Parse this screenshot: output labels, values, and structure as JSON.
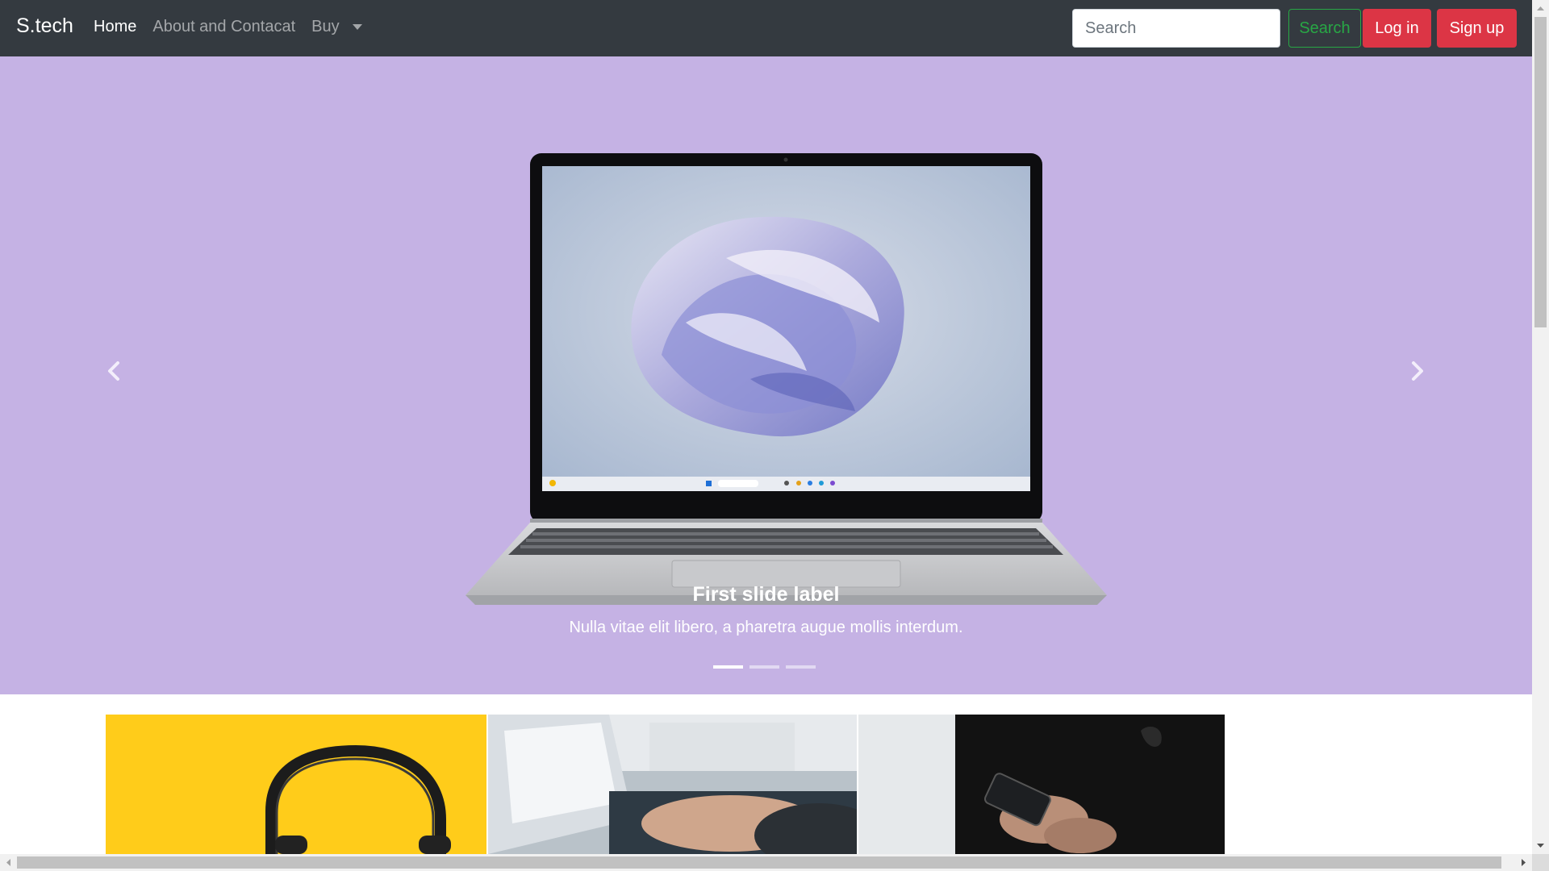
{
  "navbar": {
    "brand": "S.tech",
    "links": [
      {
        "label": "Home",
        "active": true
      },
      {
        "label": "About and Contacat",
        "active": false
      },
      {
        "label": "Buy",
        "active": false,
        "dropdown": true
      }
    ],
    "search_placeholder": "Search",
    "search_button": "Search",
    "login_button": "Log in",
    "signup_button": "Sign up"
  },
  "carousel": {
    "background": "#c5b2e4",
    "caption_title": "First slide label",
    "caption_text": "Nulla vitae elit libero, a pharetra augue mollis interdum.",
    "indicator_count": 3,
    "active_index": 0
  },
  "cards": [
    {
      "image": "headphones-on-yellow"
    },
    {
      "image": "hands-typing-on-laptop"
    },
    {
      "image": "hands-holding-smartphone"
    }
  ],
  "colors": {
    "navbar_bg": "#343a40",
    "danger": "#dc3545",
    "success": "#28a745"
  }
}
